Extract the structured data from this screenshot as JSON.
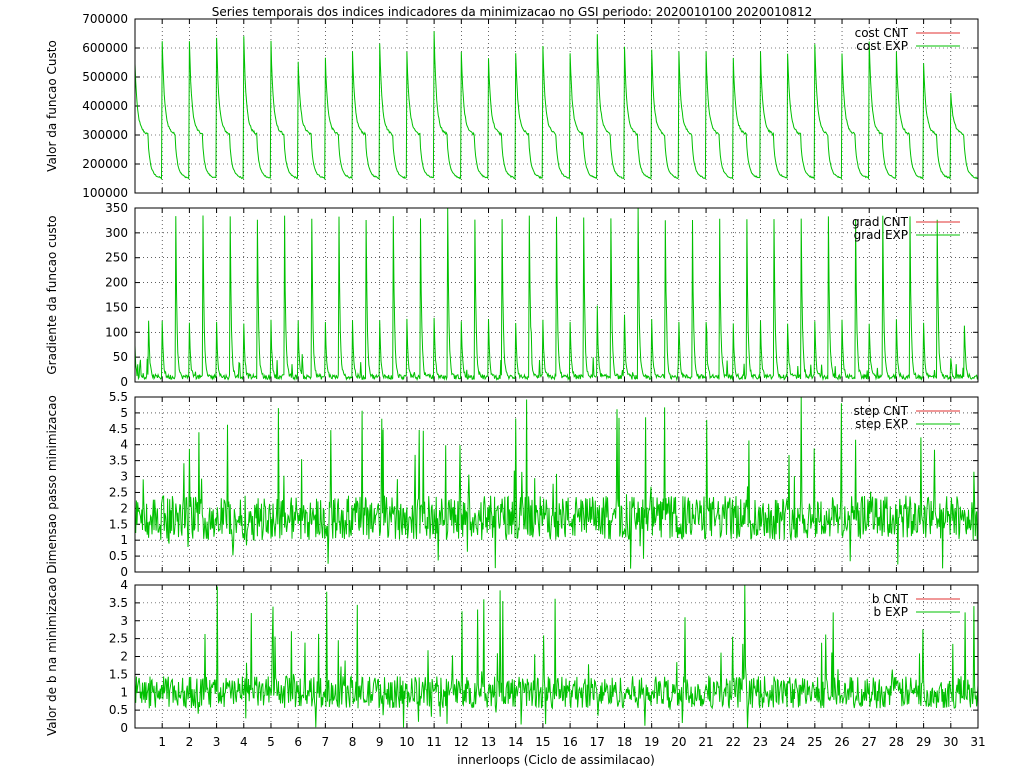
{
  "title": "Series temporais dos indices indicadores da minimizacao no GSI periodo: 2020010100 2020010812",
  "xlabel": "innerloops (Ciclo de assimilacao)",
  "colors": {
    "cnt": "#e03131",
    "exp": "#00c000",
    "grid": "#000000"
  },
  "x_ticks": [
    "1",
    "2",
    "3",
    "4",
    "5",
    "6",
    "7",
    "8",
    "9",
    "10",
    "11",
    "12",
    "13",
    "14",
    "15",
    "16",
    "17",
    "18",
    "19",
    "20",
    "21",
    "22",
    "23",
    "24",
    "25",
    "26",
    "27",
    "28",
    "29",
    "30",
    "31"
  ],
  "chart_data": [
    {
      "type": "line",
      "ylabel": "Valor da funcao Custo",
      "ylim": [
        100000,
        700000
      ],
      "yticks": [
        "100000",
        "200000",
        "300000",
        "400000",
        "500000",
        "600000",
        "700000"
      ],
      "xlim": [
        0,
        31
      ],
      "grid": true,
      "legend_position": "top-right",
      "series": [
        {
          "name": "cost CNT",
          "values": []
        },
        {
          "name": "cost EXP",
          "description": "sawtooth decay per cycle; outer loop 1 peaks ~500000-630000 decaying to ~300000, outer loop 2 peaks ~240000 decaying to ~150000",
          "peaks": [
            520000,
            600000,
            600000,
            610000,
            620000,
            600000,
            530000,
            540000,
            560000,
            590000,
            560000,
            630000,
            560000,
            540000,
            560000,
            580000,
            560000,
            620000,
            580000,
            570000,
            560000,
            560000,
            540000,
            560000,
            560000,
            590000,
            560000,
            600000,
            560000,
            520000,
            420000
          ],
          "min1": 300000,
          "min2": 150000
        }
      ]
    },
    {
      "type": "line",
      "ylabel": "Gradiente da funcao custo",
      "ylim": [
        0,
        350
      ],
      "yticks": [
        "0",
        "50",
        "100",
        "150",
        "200",
        "250",
        "300",
        "350"
      ],
      "xlim": [
        0,
        31
      ],
      "grid": true,
      "legend_position": "top-right",
      "series": [
        {
          "name": "grad CNT",
          "values": []
        },
        {
          "name": "grad EXP",
          "description": "sharp spikes at start of each outer loop decaying toward ~5-10",
          "peaks": [
            110,
            325,
            320,
            320,
            320,
            320,
            320,
            325,
            320,
            320,
            320,
            345,
            320,
            320,
            320,
            320,
            320,
            320,
            345,
            320,
            320,
            320,
            320,
            320,
            320,
            325,
            320,
            320,
            320,
            320,
            100
          ],
          "min": 5
        }
      ]
    },
    {
      "type": "line",
      "ylabel": "Dimensao passo minimizacao",
      "ylim": [
        0,
        5.5
      ],
      "yticks": [
        "0",
        "0.5",
        "1",
        "1.5",
        "2",
        "2.5",
        "3",
        "3.5",
        "4",
        "4.5",
        "5",
        "5.5"
      ],
      "xlim": [
        0,
        31
      ],
      "grid": true,
      "legend_position": "top-right",
      "series": [
        {
          "name": "step CNT",
          "values": []
        },
        {
          "name": "step EXP",
          "description": "noisy band mostly between 1 and 2.5, mean ~1.7, spikes up to ~5.3",
          "mean": 1.7,
          "max": 5.3
        }
      ]
    },
    {
      "type": "line",
      "ylabel": "Valor de b na minimizacao",
      "ylim": [
        0,
        4
      ],
      "yticks": [
        "0",
        "0.5",
        "1",
        "1.5",
        "2",
        "2.5",
        "3",
        "3.5",
        "4"
      ],
      "xlim": [
        0,
        31
      ],
      "grid": true,
      "legend_position": "top-right",
      "series": [
        {
          "name": "b CNT",
          "values": []
        },
        {
          "name": "b EXP",
          "description": "noisy band mostly between 0.5 and 1.7, mean ~1.0, spikes up to ~3.8",
          "mean": 1.0,
          "max": 3.8
        }
      ]
    }
  ]
}
